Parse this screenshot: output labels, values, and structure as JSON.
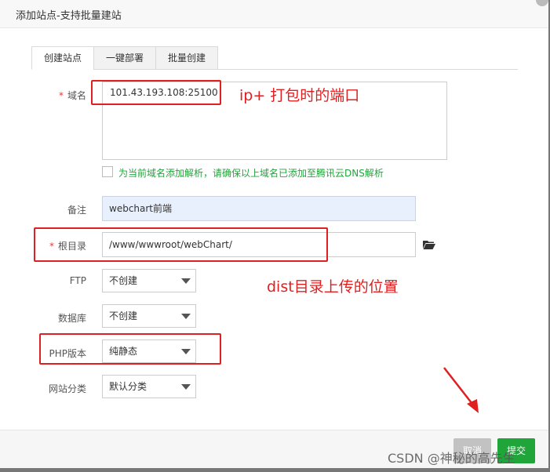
{
  "dialog": {
    "title": "添加站点-支持批量建站"
  },
  "tabs": [
    {
      "label": "创建站点",
      "active": true
    },
    {
      "label": "一键部署",
      "active": false
    },
    {
      "label": "批量创建",
      "active": false
    }
  ],
  "form": {
    "domain": {
      "required_mark": "*",
      "label": "域名",
      "value": "101.43.193.108:25100"
    },
    "dns_checkbox": {
      "checked": false,
      "label": "为当前域名添加解析，请确保以上域名已添加至腾讯云DNS解析"
    },
    "remark": {
      "label": "备注",
      "value": "webchart前端"
    },
    "root_dir": {
      "required_mark": "*",
      "label": "根目录",
      "value": "/www/wwwroot/webChart/"
    },
    "ftp": {
      "label": "FTP",
      "value": "不创建"
    },
    "database": {
      "label": "数据库",
      "value": "不创建"
    },
    "php_version": {
      "label": "PHP版本",
      "value": "纯静态"
    },
    "site_category": {
      "label": "网站分类",
      "value": "默认分类"
    }
  },
  "annotations": {
    "domain_note": "ip+ 打包时的端口",
    "dist_note": "dist目录上传的位置"
  },
  "footer": {
    "cancel_label": "取消",
    "submit_label": "提交"
  },
  "watermark": "CSDN @神秘的高先生",
  "colors": {
    "required": "#e4393c",
    "success_green": "#20a53a",
    "annotation_red": "#e02020",
    "remark_bg": "#e8f0fe"
  }
}
